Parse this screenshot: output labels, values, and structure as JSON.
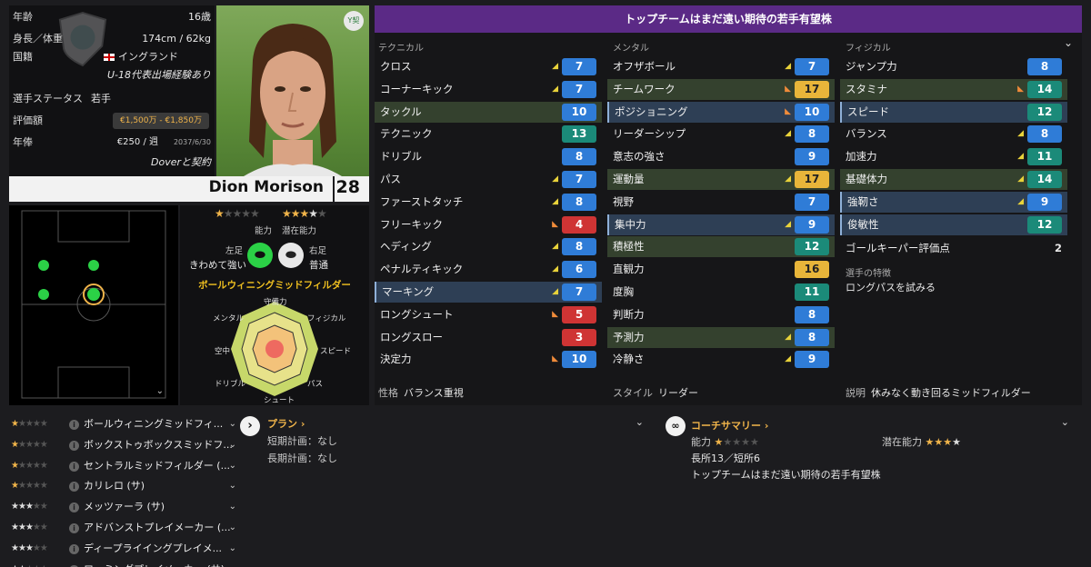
{
  "info": {
    "age_label": "年齢",
    "age": "16歳",
    "height_label": "身長／体重",
    "height": "174cm / 62kg",
    "nation_label": "国籍",
    "nation": "イングランド",
    "intl": "U-18代表出場経験あり",
    "status_label": "選手ステータス",
    "status": "若手",
    "value_label": "評価額",
    "value": "€1,500万 - €1,850万",
    "wage_label": "年俸",
    "wage": "€250 / 週",
    "contract_end": "2037/6/30",
    "contract_note": "Doverと契約"
  },
  "photo_badge": "Y契",
  "player": {
    "name": "Dion Morison",
    "age": "28"
  },
  "ability": {
    "ca_label": "能力",
    "pa_label": "潜在能力",
    "ca_stars": 1,
    "pa_stars": 3.5,
    "left_foot_label": "左足",
    "left_foot": "きわめて強い",
    "right_foot_label": "右足",
    "right_foot": "普通",
    "role": "ボールウィニングミッドフィルダー"
  },
  "radar": {
    "labels": [
      "守備力",
      "フィジカル",
      "スピード",
      "パス",
      "シュート",
      "ドリブル",
      "空中",
      "メンタル"
    ]
  },
  "banner": "トップチームはまだ遠い期待の若手有望株",
  "columns": {
    "technical": "テクニカル",
    "mental": "メンタル",
    "physical": "フィジカル"
  },
  "technical": [
    {
      "name": "クロス",
      "value": "7",
      "arrow": "up",
      "hl": ""
    },
    {
      "name": "コーナーキック",
      "value": "7",
      "arrow": "up",
      "hl": ""
    },
    {
      "name": "タックル",
      "value": "10",
      "arrow": "",
      "hl": "green"
    },
    {
      "name": "テクニック",
      "value": "13",
      "arrow": "",
      "hl": ""
    },
    {
      "name": "ドリブル",
      "value": "8",
      "arrow": "",
      "hl": ""
    },
    {
      "name": "パス",
      "value": "7",
      "arrow": "up",
      "hl": ""
    },
    {
      "name": "ファーストタッチ",
      "value": "8",
      "arrow": "up",
      "hl": ""
    },
    {
      "name": "フリーキック",
      "value": "4",
      "arrow": "down",
      "hl": ""
    },
    {
      "name": "ヘディング",
      "value": "8",
      "arrow": "up",
      "hl": ""
    },
    {
      "name": "ペナルティキック",
      "value": "6",
      "arrow": "up",
      "hl": ""
    },
    {
      "name": "マーキング",
      "value": "7",
      "arrow": "up",
      "hl": "blue"
    },
    {
      "name": "ロングシュート",
      "value": "5",
      "arrow": "down",
      "hl": ""
    },
    {
      "name": "ロングスロー",
      "value": "3",
      "arrow": "",
      "hl": ""
    },
    {
      "name": "決定力",
      "value": "10",
      "arrow": "down",
      "hl": ""
    }
  ],
  "mental": [
    {
      "name": "オフザボール",
      "value": "7",
      "arrow": "up",
      "hl": ""
    },
    {
      "name": "チームワーク",
      "value": "17",
      "arrow": "down",
      "hl": "green"
    },
    {
      "name": "ポジショニング",
      "value": "10",
      "arrow": "down",
      "hl": "blue"
    },
    {
      "name": "リーダーシップ",
      "value": "8",
      "arrow": "up",
      "hl": ""
    },
    {
      "name": "意志の強さ",
      "value": "9",
      "arrow": "",
      "hl": ""
    },
    {
      "name": "運動量",
      "value": "17",
      "arrow": "up",
      "hl": "green"
    },
    {
      "name": "視野",
      "value": "7",
      "arrow": "",
      "hl": ""
    },
    {
      "name": "集中力",
      "value": "9",
      "arrow": "up",
      "hl": "blue"
    },
    {
      "name": "積極性",
      "value": "12",
      "arrow": "",
      "hl": "green"
    },
    {
      "name": "直観力",
      "value": "16",
      "arrow": "",
      "hl": ""
    },
    {
      "name": "度胸",
      "value": "11",
      "arrow": "",
      "hl": ""
    },
    {
      "name": "判断力",
      "value": "8",
      "arrow": "",
      "hl": ""
    },
    {
      "name": "予測力",
      "value": "8",
      "arrow": "up",
      "hl": "green"
    },
    {
      "name": "冷静さ",
      "value": "9",
      "arrow": "up",
      "hl": ""
    }
  ],
  "physical": [
    {
      "name": "ジャンプ力",
      "value": "8",
      "arrow": "",
      "hl": ""
    },
    {
      "name": "スタミナ",
      "value": "14",
      "arrow": "down",
      "hl": "green"
    },
    {
      "name": "スピード",
      "value": "12",
      "arrow": "",
      "hl": "blue"
    },
    {
      "name": "バランス",
      "value": "8",
      "arrow": "up",
      "hl": ""
    },
    {
      "name": "加速力",
      "value": "11",
      "arrow": "up",
      "hl": ""
    },
    {
      "name": "基礎体力",
      "value": "14",
      "arrow": "up",
      "hl": "green"
    },
    {
      "name": "強靭さ",
      "value": "9",
      "arrow": "up",
      "hl": "blue"
    },
    {
      "name": "俊敏性",
      "value": "12",
      "arrow": "",
      "hl": "blue"
    }
  ],
  "gk": {
    "label": "ゴールキーパー評価点",
    "value": "2"
  },
  "traits": {
    "label": "選手の特徴",
    "value": "ロングパスを試みる"
  },
  "footer": {
    "personality_label": "性格",
    "personality": "バランス重視",
    "style_label": "スタイル",
    "style": "リーダー",
    "desc_label": "説明",
    "desc": "休みなく動き回るミッドフィルダー"
  },
  "roles": [
    {
      "name": "ボールウィニングミッドフィ...",
      "stars": 1
    },
    {
      "name": "ボックストゥボックスミッドフ...",
      "stars": 1
    },
    {
      "name": "セントラルミッドフィルダー (...",
      "stars": 1
    },
    {
      "name": "カリレロ (サ)",
      "stars": 1
    },
    {
      "name": "メッツァーラ (サ)",
      "stars": 3
    },
    {
      "name": "アドバンストプレイメーカー (...",
      "stars": 3
    },
    {
      "name": "ディープライイングプレイメ...",
      "stars": 3
    },
    {
      "name": "ローミングプレイメーカー (サ)",
      "stars": 2
    }
  ],
  "plan": {
    "title": "プラン",
    "short_label": "短期計画",
    "short": "なし",
    "long_label": "長期計画",
    "long": "なし"
  },
  "coach": {
    "title": "コーチサマリー",
    "ca_label": "能力",
    "pa_label": "潜在能力",
    "ca_stars": 1,
    "pa_stars": 3.5,
    "line1": "長所13／短所6",
    "line2": "トップチームはまだ遠い期待の若手有望株"
  },
  "colors": {
    "blue": "#2f7cd7",
    "teal": "#1b8a79",
    "red": "#cf3434",
    "gold": "#e8b53a",
    "banner": "#5b2a86",
    "highlight_green": "#34412e",
    "highlight_blue": "#2e3f55"
  }
}
